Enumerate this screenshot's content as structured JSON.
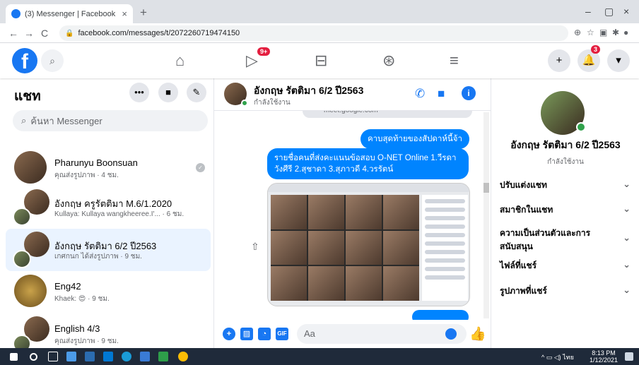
{
  "browser": {
    "tab_title": "(3) Messenger | Facebook",
    "tab_close": "×",
    "new_tab": "+",
    "url": "facebook.com/messages/t/2072260719474150",
    "win_min": "–",
    "win_max": "▢",
    "win_close": "×"
  },
  "fb_header": {
    "logo": "f",
    "video_badge": "9+",
    "notif_badge": "3"
  },
  "left": {
    "title": "แชท",
    "search_placeholder": "ค้นหา Messenger",
    "chats": [
      {
        "name": "Pharunyu Boonsuan",
        "sub": "คุณส่งรูปภาพ · 4 ชม."
      },
      {
        "name": "อังกฤษ ครูรัตติมา M.6/1.2020",
        "sub": "Kullaya: Kullaya wangkheeree.I'... · 6 ชม."
      },
      {
        "name": "อังกฤษ รัตติมา 6/2 ปี2563",
        "sub": "เกศกนก ได้ส่งรูปภาพ · 9 ชม."
      },
      {
        "name": "Eng42",
        "sub": "Khaek: 😍 · 9 ชม."
      },
      {
        "name": "English 4/3",
        "sub": "คุณส่งรูปภาพ · 9 ชม."
      }
    ]
  },
  "chat": {
    "name": "อังกฤษ รัตติมา 6/2 ปี2563",
    "status": "กำลังใช้งาน",
    "prev_link": "meet.google.com",
    "msg1": "คาบสุดท้ายของสัปดาห์นี้จ้า",
    "msg2": "รายชื่อคนที่ส่งคะแนนข้อสอบ O-NET Online 1.วีรดา วังศีรี 2.สุชาดา 3.สุภาวดี 4.วรรัตน์",
    "composer_placeholder": "Aa"
  },
  "right": {
    "name": "อังกฤษ รัตติมา 6/2 ปี2563",
    "status": "กำลังใช้งาน",
    "items": [
      "ปรับแต่งแชท",
      "สมาชิกในแชท",
      "ความเป็นส่วนตัวและการสนับสนุน",
      "ไฟล์ที่แชร์",
      "รูปภาพที่แชร์"
    ]
  },
  "taskbar": {
    "time": "8:13 PM",
    "date": "1/12/2021",
    "lang": "ไทย"
  }
}
